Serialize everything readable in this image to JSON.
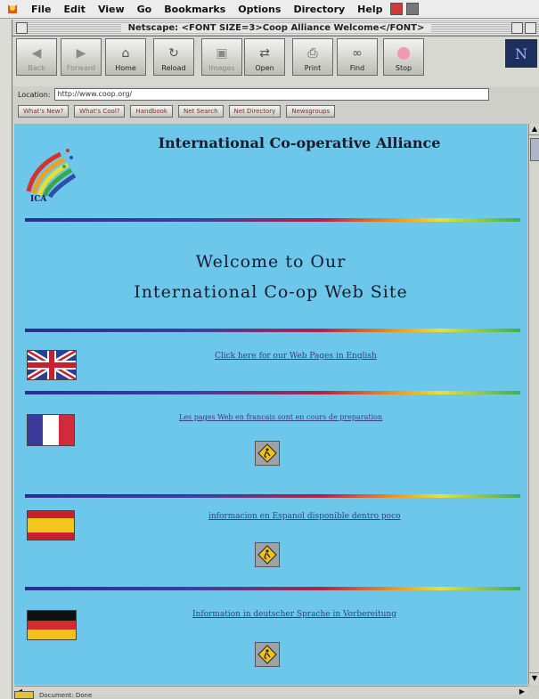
{
  "menubar": {
    "items": [
      "File",
      "Edit",
      "View",
      "Go",
      "Bookmarks",
      "Options",
      "Directory",
      "Help"
    ]
  },
  "window": {
    "title": "Netscape: <FONT SIZE=3>Coop Alliance Welcome</FONT>"
  },
  "toolbar": {
    "buttons": [
      {
        "label": "Back",
        "icon": "back-arrow-icon"
      },
      {
        "label": "Forward",
        "icon": "forward-arrow-icon"
      },
      {
        "label": "Home",
        "icon": "home-icon"
      },
      {
        "label": "Reload",
        "icon": "reload-icon"
      },
      {
        "label": "Images",
        "icon": "images-icon"
      },
      {
        "label": "Open",
        "icon": "open-icon"
      },
      {
        "label": "Print",
        "icon": "print-icon"
      },
      {
        "label": "Find",
        "icon": "binoculars-icon"
      },
      {
        "label": "Stop",
        "icon": "stop-icon"
      }
    ],
    "logo": "N"
  },
  "location": {
    "label": "Location:",
    "url": "http://www.coop.org/"
  },
  "directory_buttons": [
    "What's New?",
    "What's Cool?",
    "Handbook",
    "Net Search",
    "Net Directory",
    "Newsgroups"
  ],
  "page": {
    "logo_text": "ICA",
    "header": "International Co-operative Alliance",
    "welcome_line1": "Welcome to Our",
    "welcome_line2": "International Co-op Web Site",
    "links": {
      "english": "Click here for our Web Pages in English",
      "french": "Les pages Web en francais sont en cours de preparation",
      "spanish": "informacion en Espanol disponible dentro poco",
      "german": "Information in deutscher Sprache in Vorbereitung"
    }
  },
  "status_bar": {
    "text": "Document: Done"
  },
  "colors": {
    "page_background": "#6cc7ea",
    "link": "#3a3a8a"
  }
}
